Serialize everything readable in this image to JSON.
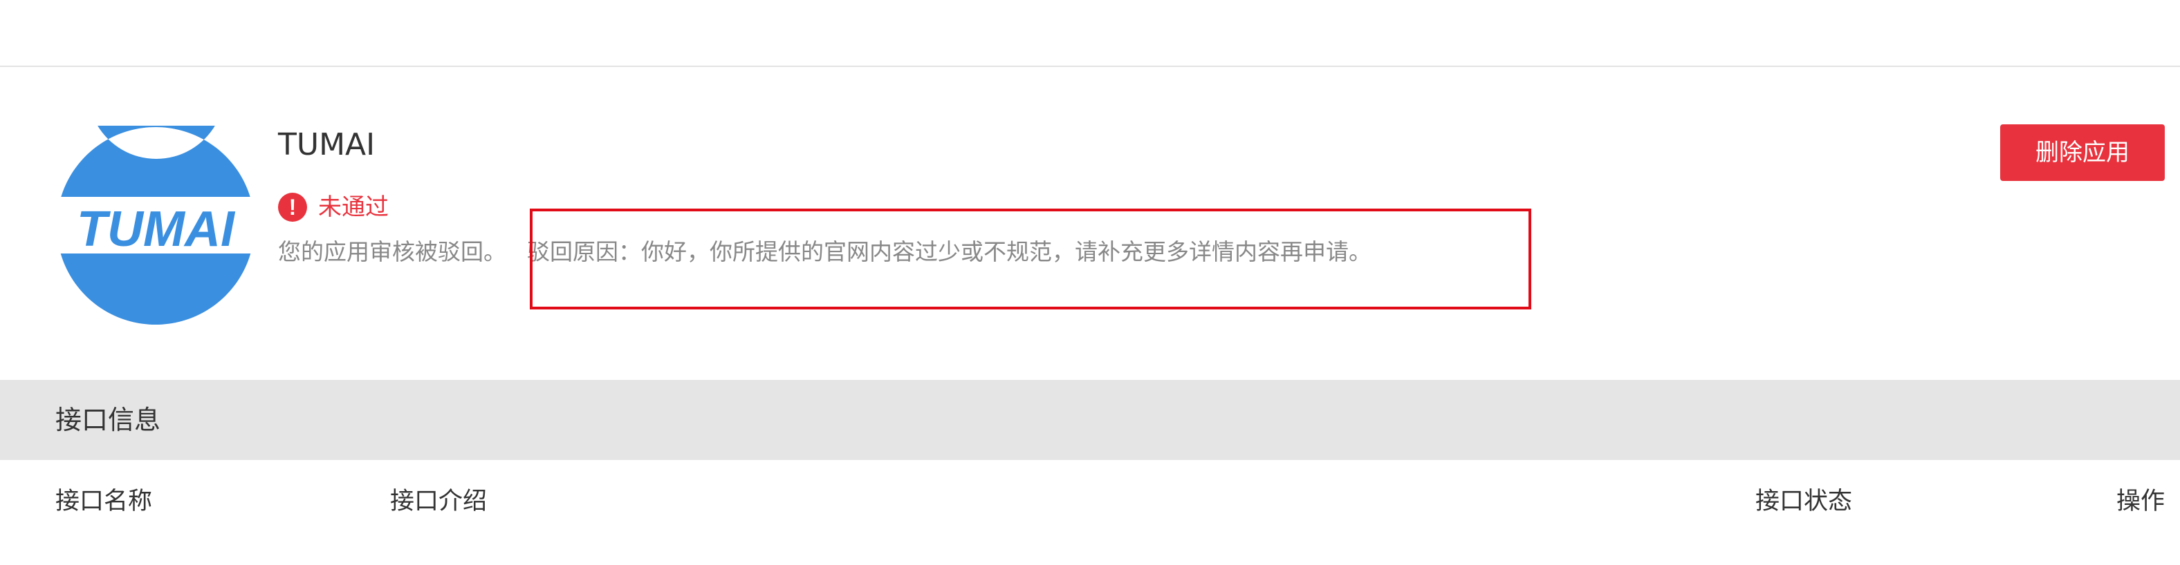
{
  "app": {
    "logo_text": "TUMAI",
    "logo_color": "#3a8fe0",
    "name": "TUMAI",
    "status": "未通过",
    "status_color": "#e8333e",
    "status_icon": "exclamation-circle-icon",
    "reject_prefix": "您的应用审核被驳回。",
    "reject_reason": "驳回原因：你好，你所提供的官网内容过少或不规范，请补充更多详情内容再申请。",
    "delete_label": "删除应用"
  },
  "interface_section": {
    "title": "接口信息",
    "columns": [
      "接口名称",
      "接口介绍",
      "接口状态",
      "操作"
    ]
  }
}
